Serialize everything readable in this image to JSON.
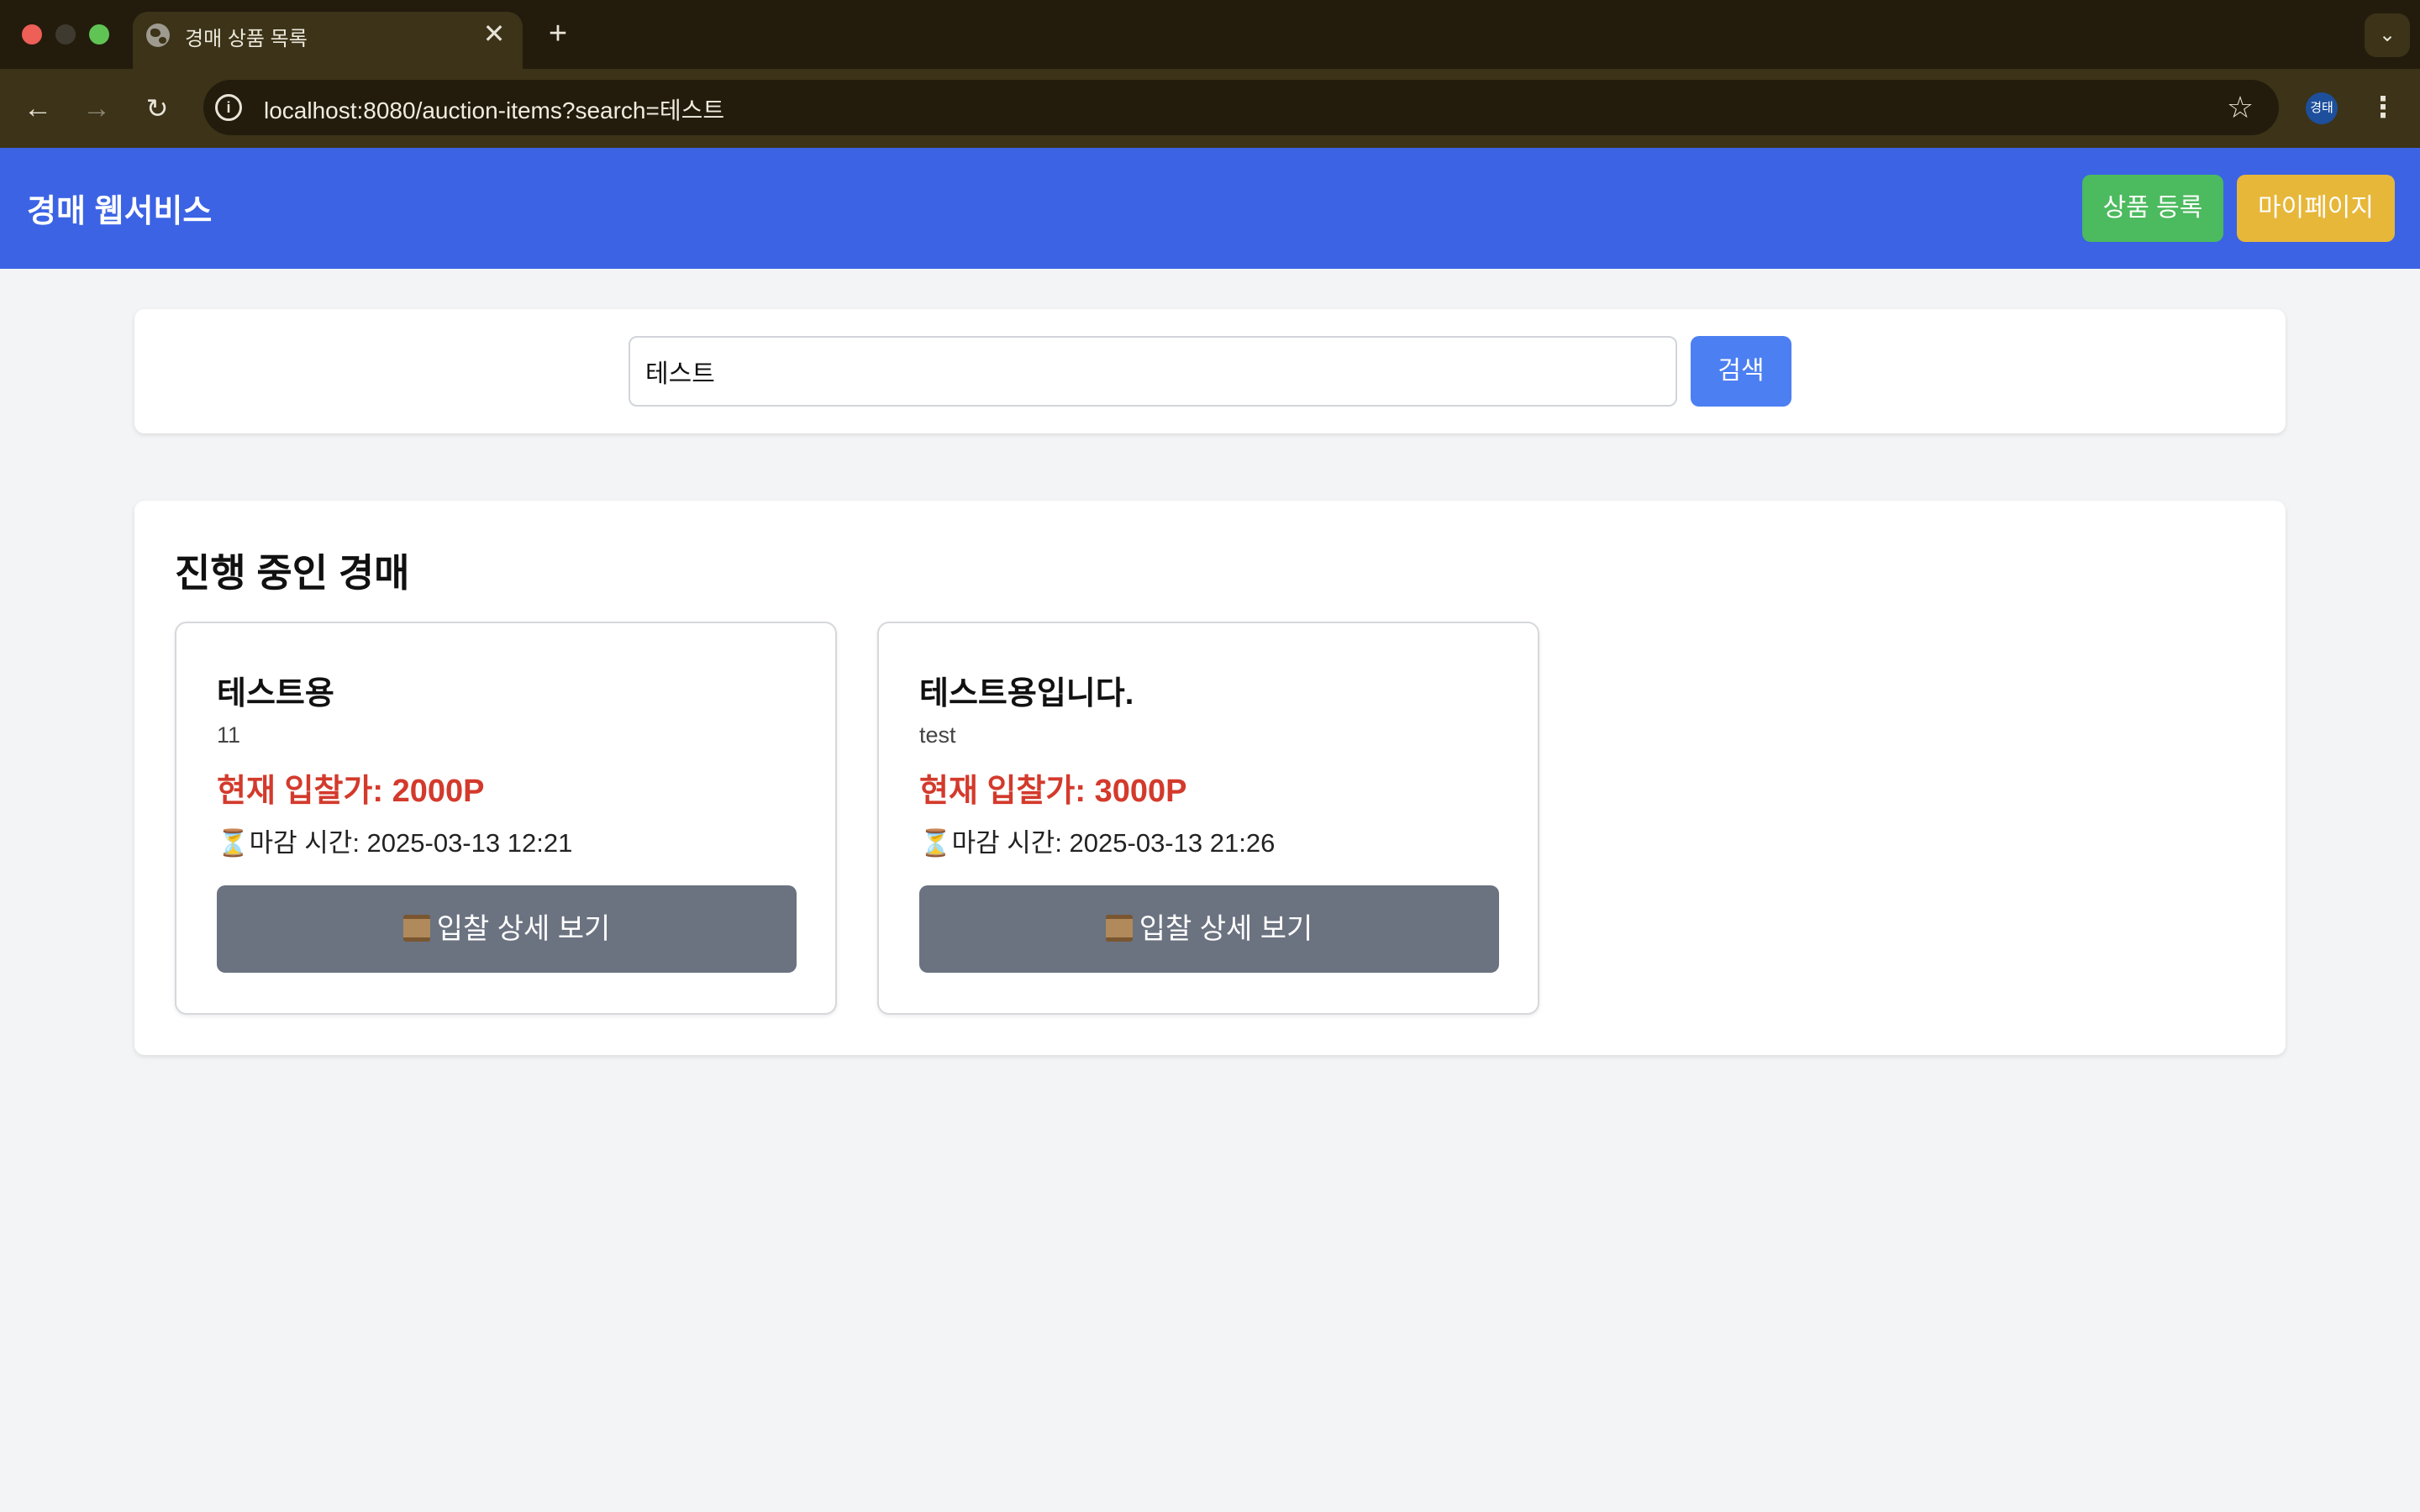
{
  "browser": {
    "tab_title": "경매 상품 목록",
    "tab_close": "✕",
    "new_tab": "+",
    "tabs_menu": "⌄",
    "url": "localhost:8080/auction-items?search=테스트",
    "profile_label": "경태",
    "nav": {
      "back": "←",
      "forward": "→",
      "reload": "↻"
    },
    "info": "i",
    "star": "☆",
    "menu": "⋮"
  },
  "header": {
    "brand": "경매 웹서비스",
    "register_label": "상품 등록",
    "mypage_label": "마이페이지",
    "colors": {
      "bar": "#3b63e4",
      "register": "#4cba5e",
      "mypage": "#e7b73a"
    }
  },
  "search": {
    "value": "테스트",
    "button_label": "검색"
  },
  "main": {
    "section_title": "진행 중인 경매",
    "items": [
      {
        "title": "테스트용",
        "desc": "11",
        "price": "현재 입찰가: 2000P",
        "deadline": "마감 시간: 2025-03-13 12:21",
        "hourglass": "⏳",
        "button_label": "입찰 상세 보기"
      },
      {
        "title": "테스트용입니다.",
        "desc": "test",
        "price": "현재 입찰가: 3000P",
        "deadline": "마감 시간: 2025-03-13 21:26",
        "hourglass": "⏳",
        "button_label": "입찰 상세 보기"
      }
    ]
  }
}
